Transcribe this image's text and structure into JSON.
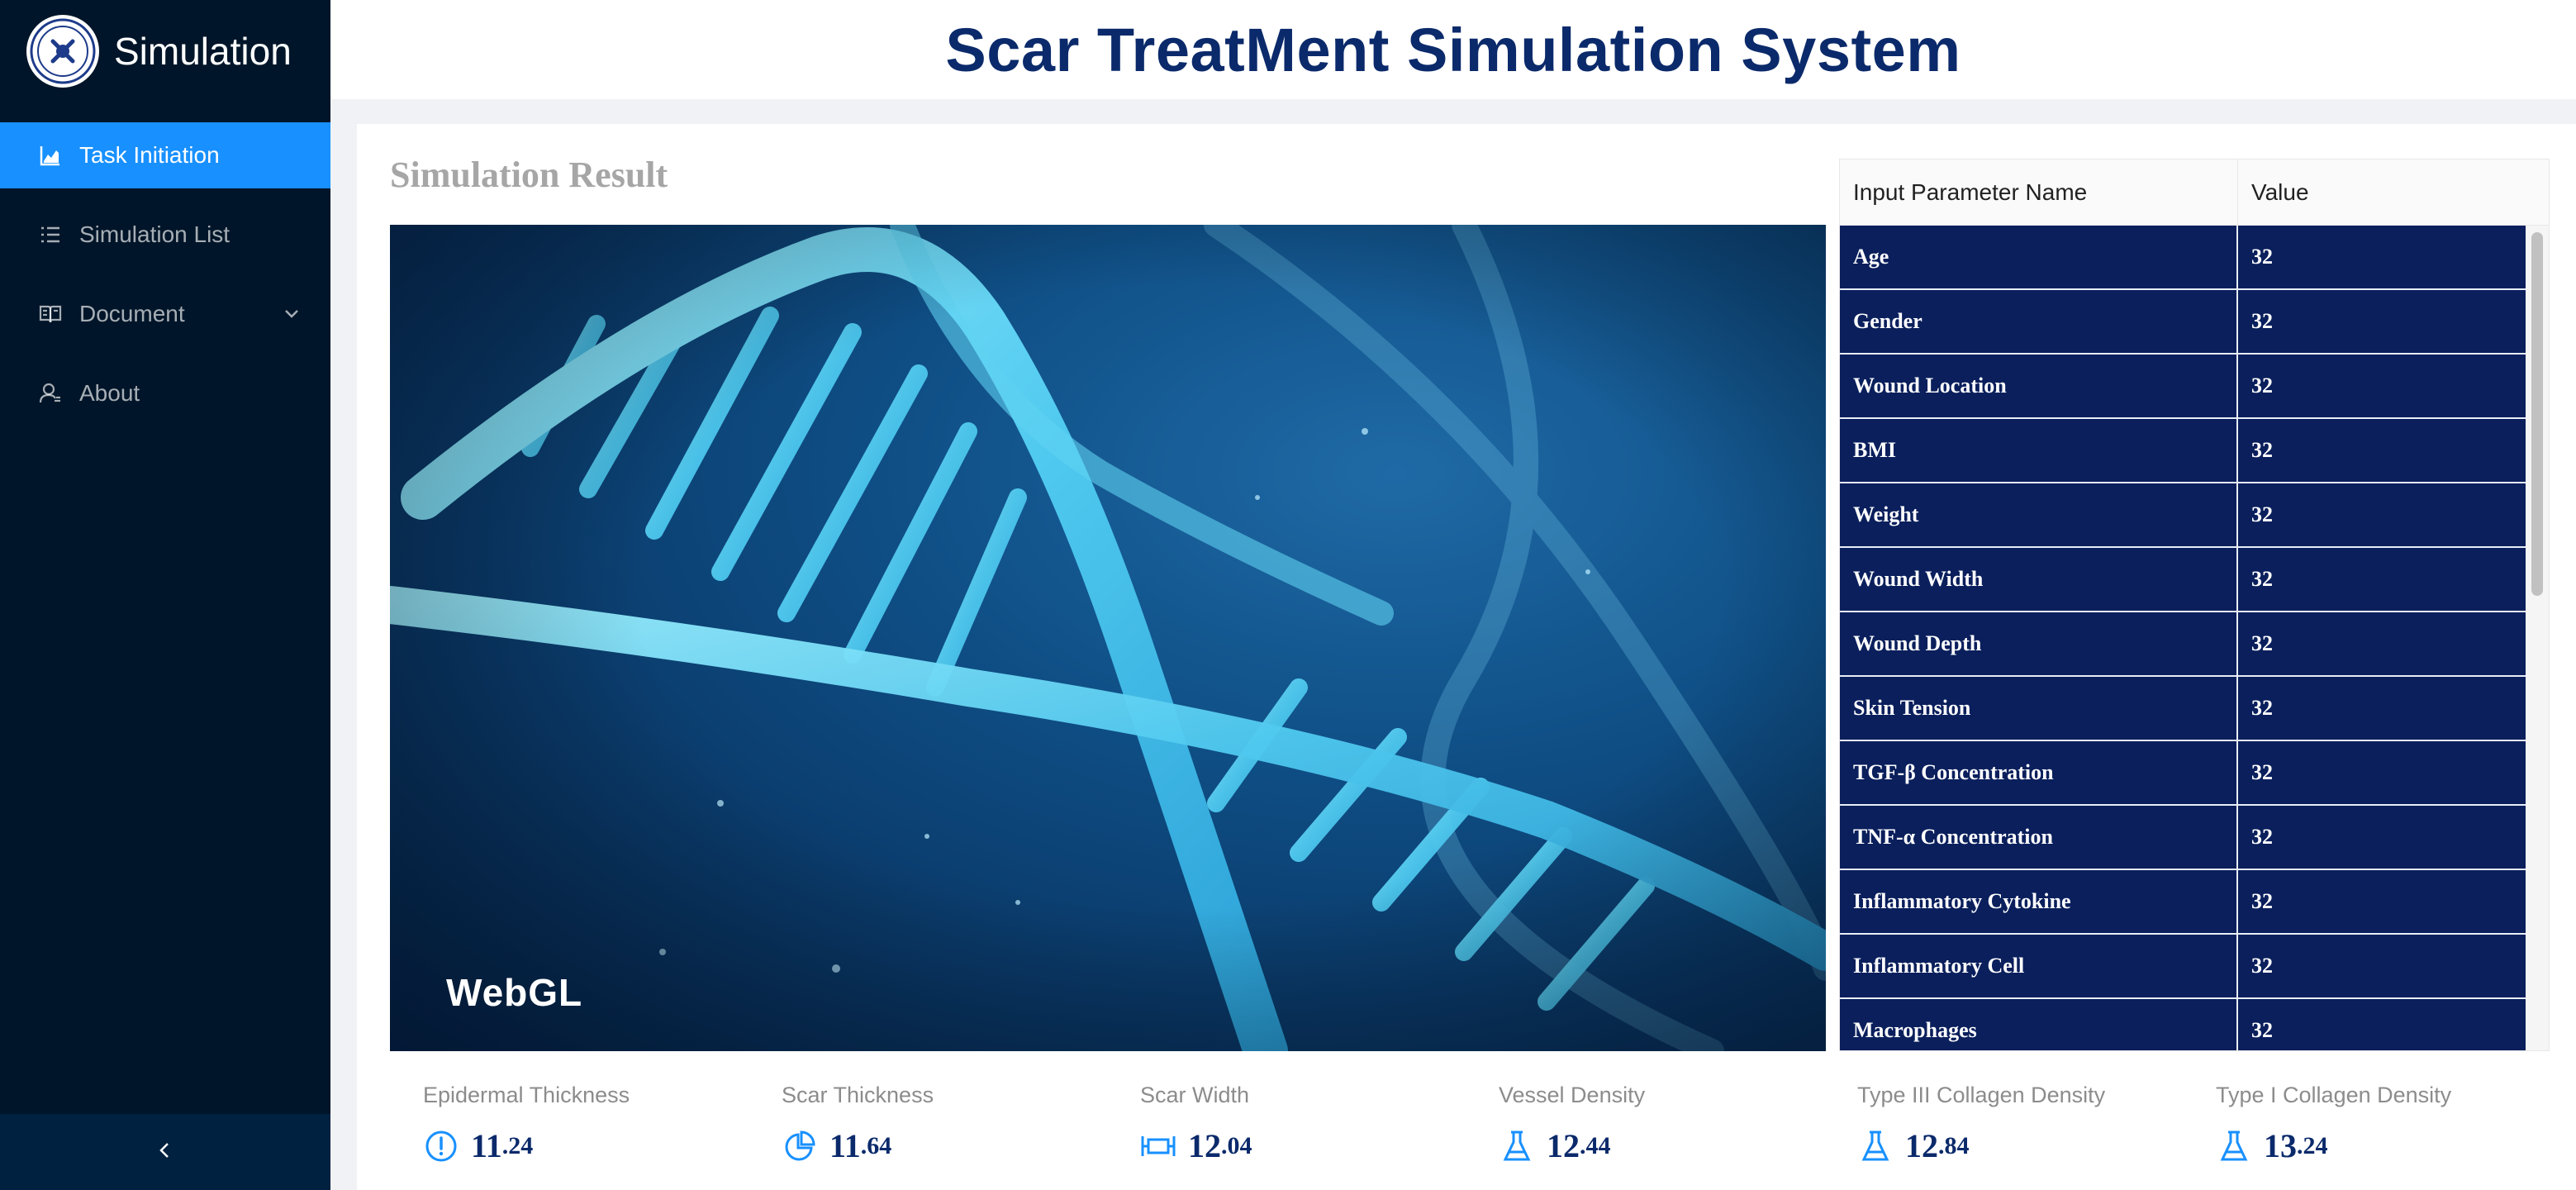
{
  "sidebar": {
    "brand_title": "Simulation",
    "items": [
      {
        "label": "Task Initiation",
        "icon": "chart-icon",
        "active": true
      },
      {
        "label": "Simulation List",
        "icon": "list-icon"
      },
      {
        "label": "Document",
        "icon": "book-icon",
        "has_submenu": true
      },
      {
        "label": "About",
        "icon": "user-icon"
      }
    ],
    "collapse_icon": "chevron-left-icon"
  },
  "header": {
    "title": "Scar TreatMent Simulation System"
  },
  "main": {
    "section_title": "Simulation Result",
    "viewer_label": "WebGL",
    "table": {
      "headers": [
        "Input Parameter Name",
        "Value"
      ],
      "rows": [
        {
          "name": "Age",
          "value": "32"
        },
        {
          "name": "Gender",
          "value": "32"
        },
        {
          "name": "Wound Location",
          "value": "32"
        },
        {
          "name": "BMI",
          "value": "32"
        },
        {
          "name": "Weight",
          "value": "32"
        },
        {
          "name": "Wound Width",
          "value": "32"
        },
        {
          "name": "Wound Depth",
          "value": "32"
        },
        {
          "name": "Skin Tension",
          "value": "32"
        },
        {
          "name": "TGF-β Concentration",
          "value": "32"
        },
        {
          "name": "TNF-α Concentration",
          "value": "32"
        },
        {
          "name": "Inflammatory Cytokine",
          "value": "32"
        },
        {
          "name": "Inflammatory Cell",
          "value": "32"
        },
        {
          "name": "Macrophages",
          "value": "32"
        }
      ]
    },
    "stats": [
      {
        "label": "Epidermal Thickness",
        "int": "11",
        "dec": ".24",
        "icon": "info-circle-icon"
      },
      {
        "label": "Scar Thickness",
        "int": "11",
        "dec": ".64",
        "icon": "pie-chart-icon"
      },
      {
        "label": "Scar Width",
        "int": "12",
        "dec": ".04",
        "icon": "width-measure-icon"
      },
      {
        "label": "Vessel Density",
        "int": "12",
        "dec": ".44",
        "icon": "flask-icon"
      },
      {
        "label": "Type III Collagen Density",
        "int": "12",
        "dec": ".84",
        "icon": "flask-icon"
      },
      {
        "label": "Type I Collagen Density",
        "int": "13",
        "dec": ".24",
        "icon": "flask-icon"
      }
    ]
  },
  "colors": {
    "sidebar_bg": "#001529",
    "active_item": "#1890ff",
    "title_blue": "#0b2a6b",
    "table_row_bg": "#0a1f5c"
  }
}
